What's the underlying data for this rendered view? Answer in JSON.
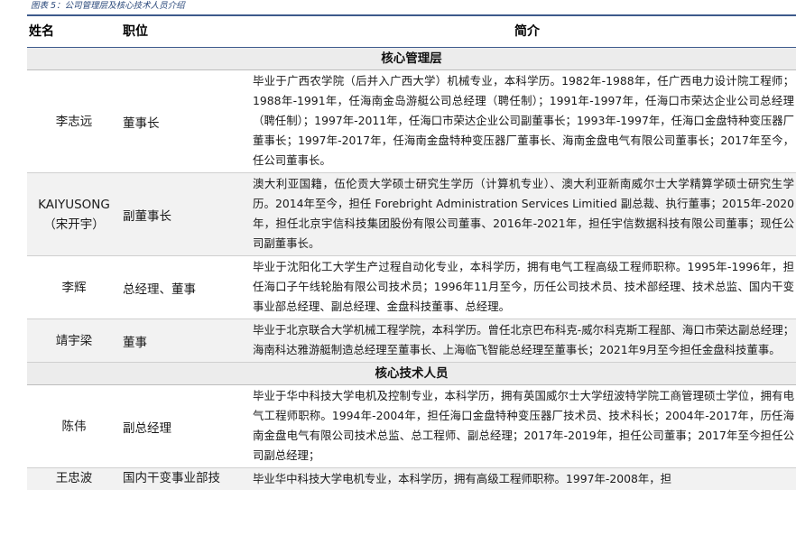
{
  "caption": "图表 5：公司管理层及核心技术人员介绍",
  "table": {
    "headers": [
      "姓名",
      "职位",
      "简介"
    ],
    "sections": [
      {
        "title": "核心管理层",
        "rows": [
          {
            "name": "李志远",
            "name_sub": "",
            "position": "董事长",
            "intro": "毕业于广西农学院（后并入广西大学）机械专业，本科学历。1982年-1988年，任广西电力设计院工程师；1988年-1991年，任海南金岛游艇公司总经理（聘任制）；1991年-1997年，任海口市荣达企业公司总经理（聘任制）；1997年-2011年，任海口市荣达企业公司副董事长；1993年-1997年，任海口金盘特种变压器厂董事长；1997年-2017年，任海南金盘特种变压器厂董事长、海南金盘电气有限公司董事长；2017年至今，任公司董事长。"
          },
          {
            "name": "KAIYUSONG",
            "name_sub": "（宋开宇）",
            "position": "副董事长",
            "intro": "澳大利亚国籍，伍伦贡大学硕士研究生学历（计算机专业）、澳大利亚新南威尔士大学精算学硕士研究生学历。2014年至今，担任 Forebright Administration Services Limitied 副总裁、执行董事；2015年-2020年，担任北京宇信科技集团股份有限公司董事、2016年-2021年，担任宇信数据科技有限公司董事；现任公司副董事长。"
          },
          {
            "name": "李辉",
            "name_sub": "",
            "position": "总经理、董事",
            "intro": "毕业于沈阳化工大学生产过程自动化专业，本科学历，拥有电气工程高级工程师职称。1995年-1996年，担任海口子午线轮胎有限公司技术员；1996年11月至今，历任公司技术员、技术部经理、技术总监、国内干变事业部总经理、副总经理、金盘科技董事、总经理。"
          },
          {
            "name": "靖宇梁",
            "name_sub": "",
            "position": "董事",
            "intro": "毕业于北京联合大学机械工程学院，本科学历。曾任北京巴布科克-威尔科克斯工程部、海口市荣达副总经理；海南科达雅游艇制造总经理至董事长、上海临飞智能总经理至董事长；2021年9月至今担任金盘科技董事。"
          }
        ]
      },
      {
        "title": "核心技术人员",
        "rows": [
          {
            "name": "陈伟",
            "name_sub": "",
            "position": "副总经理",
            "intro": "毕业于华中科技大学电机及控制专业，本科学历，拥有英国威尔士大学纽波特学院工商管理硕士学位，拥有电气工程师职称。1994年-2004年，担任海口金盘特种变压器厂技术员、技术科长；2004年-2017年，历任海南金盘电气有限公司技术总监、总工程师、副总经理；2017年-2019年，担任公司董事；2017年至今担任公司副总经理；"
          },
          {
            "name": "王忠波",
            "name_sub": "",
            "position": "国内干变事业部技",
            "intro": "毕业华中科技大学电机专业，本科学历，拥有高级工程师职称。1997年-2008年，担"
          }
        ]
      }
    ]
  }
}
